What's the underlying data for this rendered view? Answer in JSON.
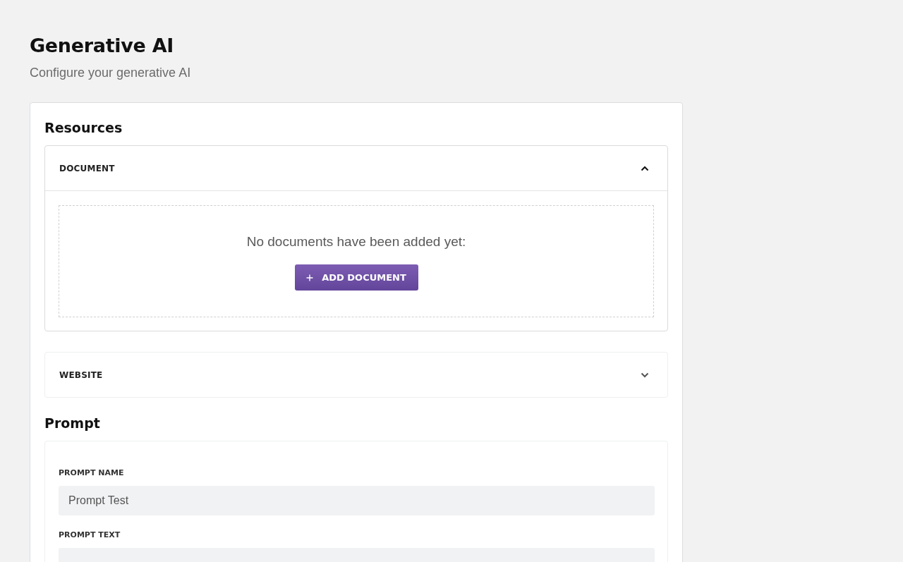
{
  "page": {
    "title": "Generative AI",
    "subtitle": "Configure your generative AI"
  },
  "resources": {
    "title": "Resources",
    "sections": [
      {
        "label": "DOCUMENT",
        "expanded": true,
        "empty_message": "No documents have been added yet:",
        "add_button": {
          "label": "ADD DOCUMENT"
        }
      },
      {
        "label": "WEBSITE",
        "expanded": false
      }
    ]
  },
  "prompt": {
    "title": "Prompt",
    "fields": [
      {
        "kind": "input",
        "label": "PROMPT NAME",
        "value": "Prompt Test"
      },
      {
        "kind": "textarea",
        "label": "PROMPT TEXT"
      }
    ]
  }
}
